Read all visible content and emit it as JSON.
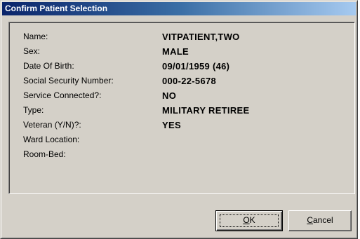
{
  "window": {
    "title": "Confirm Patient Selection"
  },
  "fields": [
    {
      "label": "Name:",
      "value": "VITPATIENT,TWO"
    },
    {
      "label": "Sex:",
      "value": "MALE"
    },
    {
      "label": "Date Of Birth:",
      "value": "09/01/1959 (46)"
    },
    {
      "label": "Social Security Number:",
      "value": "000-22-5678"
    },
    {
      "label": "Service Connected?:",
      "value": "NO"
    },
    {
      "label": "Type:",
      "value": "MILITARY RETIREE"
    },
    {
      "label": "Veteran (Y/N)?:",
      "value": "YES"
    },
    {
      "label": "Ward Location:",
      "value": ""
    },
    {
      "label": "Room-Bed:",
      "value": ""
    }
  ],
  "buttons": {
    "ok": {
      "accel": "O",
      "rest": "K"
    },
    "cancel": {
      "accel": "C",
      "rest": "ancel"
    }
  }
}
